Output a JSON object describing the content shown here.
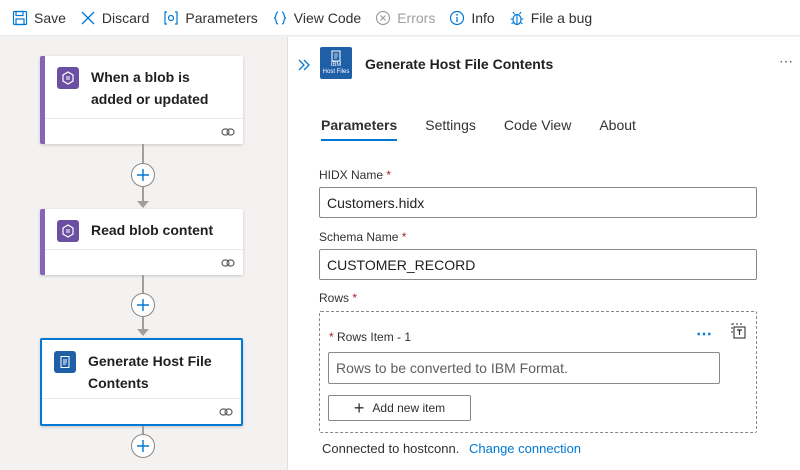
{
  "toolbar": {
    "save": "Save",
    "discard": "Discard",
    "parameters": "Parameters",
    "view_code": "View Code",
    "errors": "Errors",
    "info": "Info",
    "file_bug": "File a bug"
  },
  "workflow": {
    "trigger": {
      "title": "When a blob is added or updated",
      "icon": "blob-icon"
    },
    "action1": {
      "title": "Read blob content",
      "icon": "blob-icon"
    },
    "action2": {
      "title": "Generate Host File Contents",
      "icon": "ibm-host-files-icon"
    }
  },
  "panel": {
    "title": "Generate Host File Contents",
    "logo_text_1": "IBM",
    "logo_text_2": "Host Files",
    "tabs": [
      "Parameters",
      "Settings",
      "Code View",
      "About"
    ],
    "active_tab": "Parameters",
    "hidx_label": "HIDX Name",
    "hidx_value": "Customers.hidx",
    "schema_label": "Schema Name",
    "schema_value": "CUSTOMER_RECORD",
    "rows_label": "Rows",
    "rows_item_label": "Rows Item - 1",
    "rows_item_placeholder": "Rows to be converted to IBM Format.",
    "add_item": "Add new item",
    "required_mark": "*",
    "connection_text": "Connected to hostconn.",
    "change_connection": "Change connection"
  },
  "colors": {
    "accent": "#0078d4",
    "trigger_accent": "#8764b8",
    "required": "#a4262c"
  }
}
